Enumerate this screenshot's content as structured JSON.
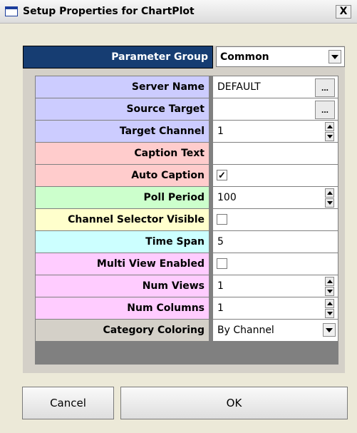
{
  "window": {
    "title": "Setup Properties for ChartPlot",
    "close_label": "X"
  },
  "parameter_group": {
    "label": "Parameter Group",
    "value": "Common"
  },
  "properties": {
    "server_name": {
      "label": "Server Name",
      "value": "DEFAULT",
      "browse": "..."
    },
    "source_target": {
      "label": "Source Target",
      "value": "",
      "browse": "..."
    },
    "target_channel": {
      "label": "Target Channel",
      "value": "1"
    },
    "caption_text": {
      "label": "Caption Text",
      "value": ""
    },
    "auto_caption": {
      "label": "Auto Caption",
      "checked": true,
      "mark": "✓"
    },
    "poll_period": {
      "label": "Poll Period",
      "value": "100"
    },
    "channel_selector_visible": {
      "label": "Channel Selector Visible",
      "checked": false
    },
    "time_span": {
      "label": "Time Span",
      "value": "5"
    },
    "multi_view_enabled": {
      "label": "Multi View Enabled",
      "checked": false
    },
    "num_views": {
      "label": "Num Views",
      "value": "1"
    },
    "num_columns": {
      "label": "Num Columns",
      "value": "1"
    },
    "category_coloring": {
      "label": "Category Coloring",
      "value": "By Channel"
    }
  },
  "buttons": {
    "cancel": "Cancel",
    "ok": "OK"
  },
  "colors": {
    "blue_rows": "#ccccff",
    "red_rows": "#ffcccc",
    "green_rows": "#ccffcc",
    "yellow_rows": "#ffffcc",
    "cyan_rows": "#ccffff",
    "magenta_rows": "#ffccff",
    "gray_rows": "#d4d0c8",
    "header_bg": "#163d72"
  }
}
